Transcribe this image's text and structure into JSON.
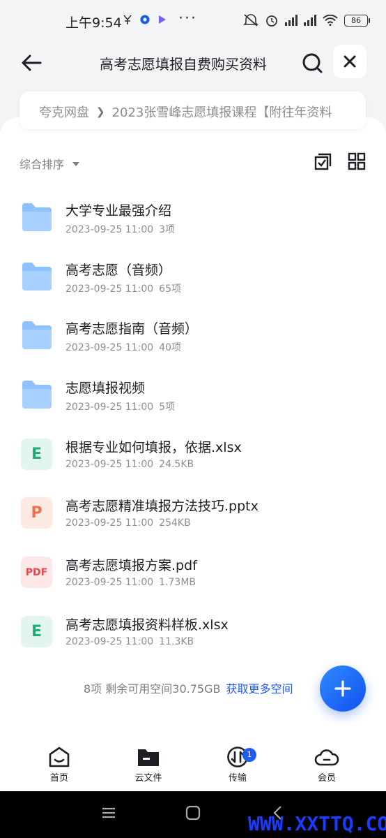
{
  "status_bar": {
    "time": "上午9:54",
    "battery": "86"
  },
  "header": {
    "title": "高考志愿填报自费购买资料"
  },
  "breadcrumb": {
    "root": "夸克网盘",
    "current": "2023张雪峰志愿填报课程【附往年资料"
  },
  "toolbar": {
    "sort_label": "综合排序"
  },
  "files": [
    {
      "type": "folder",
      "name": "大学专业最强介绍",
      "date": "2023-09-25 11:00",
      "info": "3项"
    },
    {
      "type": "folder",
      "name": "高考志愿（音频）",
      "date": "2023-09-25 11:00",
      "info": "65项"
    },
    {
      "type": "folder",
      "name": "高考志愿指南（音频）",
      "date": "2023-09-25 11:00",
      "info": "40项"
    },
    {
      "type": "folder",
      "name": "志愿填报视频",
      "date": "2023-09-25 11:00",
      "info": "5项"
    },
    {
      "type": "xlsx",
      "badge": "E",
      "name": "根据专业如何填报，依据.xlsx",
      "date": "2023-09-25 11:00",
      "info": "24.5KB"
    },
    {
      "type": "pptx",
      "badge": "P",
      "name": "高考志愿精准填报方法技巧.pptx",
      "date": "2023-09-25 11:00",
      "info": "254KB"
    },
    {
      "type": "pdf",
      "badge": "PDF",
      "name": "高考志愿填报方案.pdf",
      "date": "2023-09-25 11:00",
      "info": "1.73MB"
    },
    {
      "type": "xlsx",
      "badge": "E",
      "name": "高考志愿填报资料样板.xlsx",
      "date": "2023-09-25 11:00",
      "info": "11.3KB"
    }
  ],
  "storage": {
    "summary": "8项 剩余可用空间30.75GB",
    "link": "获取更多空间"
  },
  "bottom_nav": [
    {
      "label": "首页",
      "icon": "home-icon"
    },
    {
      "label": "云文件",
      "icon": "folder-icon"
    },
    {
      "label": "传输",
      "icon": "transfer-icon",
      "badge": "1"
    },
    {
      "label": "会员",
      "icon": "cloud-icon"
    }
  ],
  "watermark": "WWW.XXTTQ.COM",
  "colors": {
    "accent": "#1f5cf0",
    "folder": "#8ec2ff",
    "xlsx_bg": "#e3f6ee",
    "xlsx_fg": "#1fae7a",
    "pptx_bg": "#fdebe3",
    "pptx_fg": "#f2704a",
    "pdf_bg": "#fde8e8",
    "pdf_fg": "#e5484d"
  }
}
